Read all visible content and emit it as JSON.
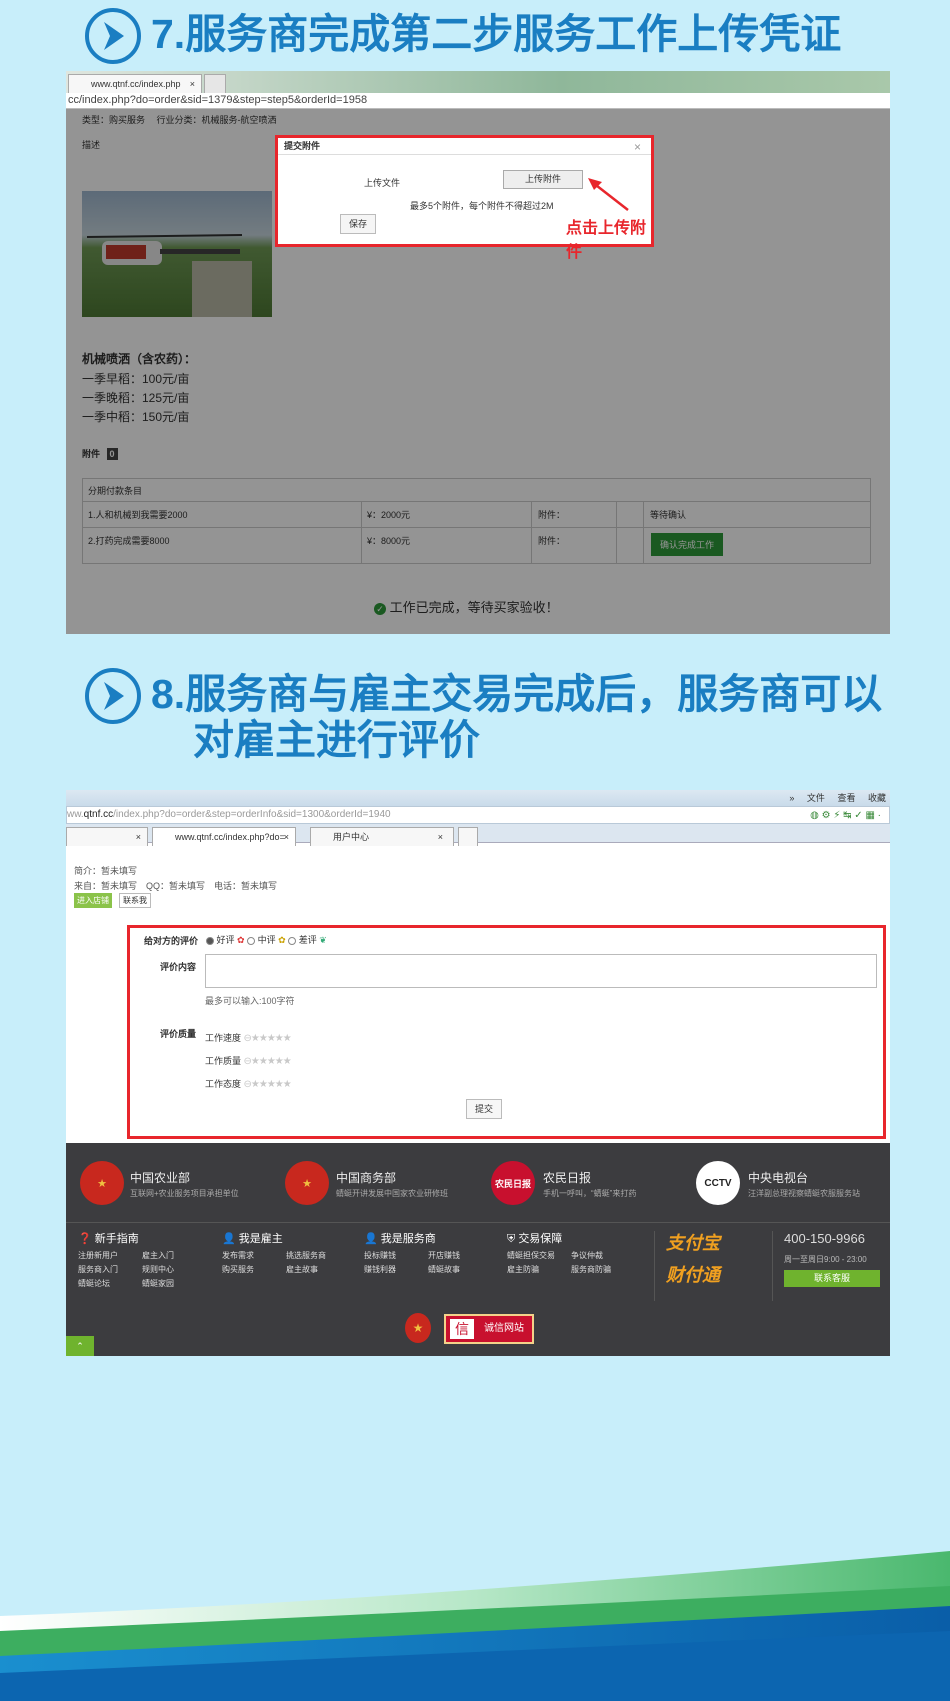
{
  "step7": {
    "title": "7.服务商完成第二步服务工作上传凭证",
    "tab1": "www.qtnf.cc/index.php",
    "address": "cc/index.php?do=order&sid=1379&step=step5&orderId=1958",
    "type_line": "类型：购买服务　 行业分类：机械服务-航空喷洒",
    "desc_label": "描述",
    "svc_title": "机械喷洒（含农药）：",
    "prices": [
      "一季早稻：100元/亩",
      "一季晚稻：125元/亩",
      "一季中稻：150元/亩"
    ],
    "attach_label": "附件",
    "attach_count": "0",
    "installment_header": "分期付款条目",
    "rows": [
      {
        "item": "1.人和机械到我需要2000",
        "amount": "¥：2000元",
        "attach": "附件：",
        "status": "等待确认"
      },
      {
        "item": "2.打药完成需要8000",
        "amount": "¥：8000元",
        "attach": "附件：",
        "btn": "确认完成工作"
      }
    ],
    "done_msg": "工作已完成，等待买家验收！",
    "dialog": {
      "title": "提交附件",
      "close": "×",
      "file_label": "上传文件",
      "upload_btn": "上传附件",
      "hint": "最多5个附件，每个附件不得超过2M",
      "save_btn": "保存"
    },
    "annotation": "点击上传附件"
  },
  "step8": {
    "title_l1": "8.服务商与雇主交易完成后，服务商可以",
    "title_l2": "对雇主进行评价",
    "menu": [
      "»",
      "文件",
      "查看",
      "收藏"
    ],
    "address_pre": "ww.",
    "address_dom": "qtnf.cc",
    "address_rest": "/index.php?do=order&step=orderInfo&sid=1300&orderId=1940",
    "tabs": [
      "",
      "www.qtnf.cc/index.php?do=",
      "用户中心"
    ],
    "intro": "简介：暂未填写",
    "from": "来自：暂未填写　QQ：暂未填写　电话：暂未填写",
    "btn_shop": "进入店铺",
    "btn_contact": "联系我",
    "rate_label": "给对方的评价",
    "opts": [
      "好评",
      "中评",
      "差评"
    ],
    "content_label": "评价内容",
    "limit": "最多可以输入:100字符",
    "quality_label": "评价质量",
    "qualities": [
      "工作速度",
      "工作质量",
      "工作态度"
    ],
    "submit": "提交",
    "footer_orgs": [
      {
        "name": "中国农业部",
        "sub": "互联网+农业服务项目承担单位"
      },
      {
        "name": "中国商务部",
        "sub": "蜻蜓开讲发展中国家农业研修班"
      },
      {
        "name": "农民日报",
        "sub": "手机一呼叫，“蜻蜓”来打药"
      },
      {
        "name": "中央电视台",
        "sub": "汪洋副总理视察蜻蜓农服服务站"
      }
    ],
    "footer_cols": [
      {
        "h": "新手指南",
        "items": [
          "注册新用户",
          "雇主入门",
          "服务商入门",
          "规则中心",
          "蜻蜓论坛",
          "蜻蜓家园"
        ]
      },
      {
        "h": "我是雇主",
        "items": [
          "发布需求",
          "挑选服务商",
          "购买服务",
          "雇主故事"
        ]
      },
      {
        "h": "我是服务商",
        "items": [
          "投标赚钱",
          "开店赚钱",
          "赚钱利器",
          "蜻蜓故事"
        ]
      },
      {
        "h": "交易保障",
        "items": [
          "蜻蜓担保交易",
          "争议仲裁",
          "雇主防骗",
          "服务商防骗"
        ]
      }
    ],
    "pay1": "支付宝",
    "pay2": "财付通",
    "phone": "400-150-9966",
    "hours": "周一至周日9:00 - 23:00",
    "service_btn": "联系客服",
    "cert": "诚信网站",
    "cert_char": "信",
    "cctv": "CCTV",
    "paper": "农民日报"
  }
}
